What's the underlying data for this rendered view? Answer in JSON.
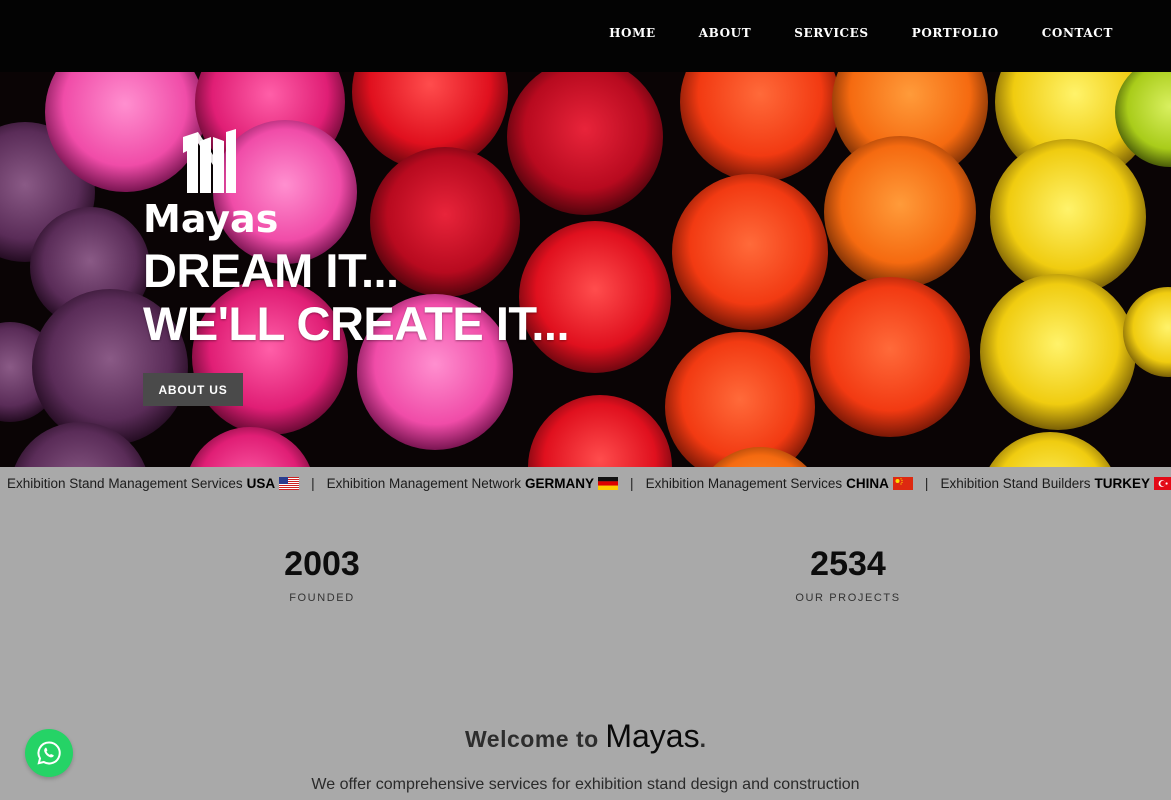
{
  "nav": {
    "items": [
      {
        "label": "HOME"
      },
      {
        "label": "ABOUT"
      },
      {
        "label": "SERVICES"
      },
      {
        "label": "PORTFOLIO"
      },
      {
        "label": "CONTACT"
      }
    ]
  },
  "hero": {
    "logo_text": "Mayas",
    "headline_1": "DREAM IT...",
    "headline_2": "WE'LL CREATE IT...",
    "button_label": "ABOUT US"
  },
  "ticker": {
    "separator": "|",
    "items": [
      {
        "text": "Exhibition Stand Management Services",
        "country": "USA",
        "flag": "us-flag"
      },
      {
        "text": "Exhibition Management Network",
        "country": "GERMANY",
        "flag": "de-flag"
      },
      {
        "text": "Exhibition Management Services",
        "country": "CHINA",
        "flag": "cn-flag"
      },
      {
        "text": "Exhibition Stand Builders",
        "country": "TURKEY",
        "flag": "tr-flag"
      }
    ]
  },
  "stats": [
    {
      "value": "2003",
      "label": "FOUNDED"
    },
    {
      "value": "2534",
      "label": "OUR PROJECTS"
    }
  ],
  "welcome": {
    "prefix": "Welcome to",
    "brand": "Mayas",
    "suffix": ".",
    "subtitle": "We offer comprehensive services for exhibition stand design and construction"
  },
  "whatsapp": {
    "icon": "whatsapp-icon",
    "color": "#25d366"
  },
  "colors": {
    "nav_bg": "#030303",
    "page_bg": "#a9a9a9",
    "button_bg": "#4a4a4a"
  }
}
